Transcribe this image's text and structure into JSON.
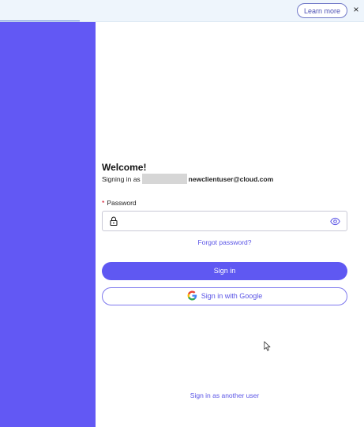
{
  "banner": {
    "learn_more_label": "Learn more",
    "close_glyph": "×"
  },
  "login": {
    "welcome": "Welcome!",
    "signing_in_as_prefix": "Signing in as",
    "email_visible": "newclientuser@cloud.com",
    "password_label": "Password",
    "required_mark": "*",
    "forgot_password": "Forgot password?",
    "sign_in_button": "Sign in",
    "google_button": "Sign in with Google",
    "another_user": "Sign in as another user"
  },
  "colors": {
    "brand_purple": "#6258f4",
    "button_purple": "#5f58f2",
    "link": "#5a54e6",
    "banner_bg": "#eef5fc"
  },
  "icons": [
    "lock-icon",
    "eye-icon",
    "google-logo-icon",
    "close-icon",
    "mouse-cursor-icon"
  ]
}
